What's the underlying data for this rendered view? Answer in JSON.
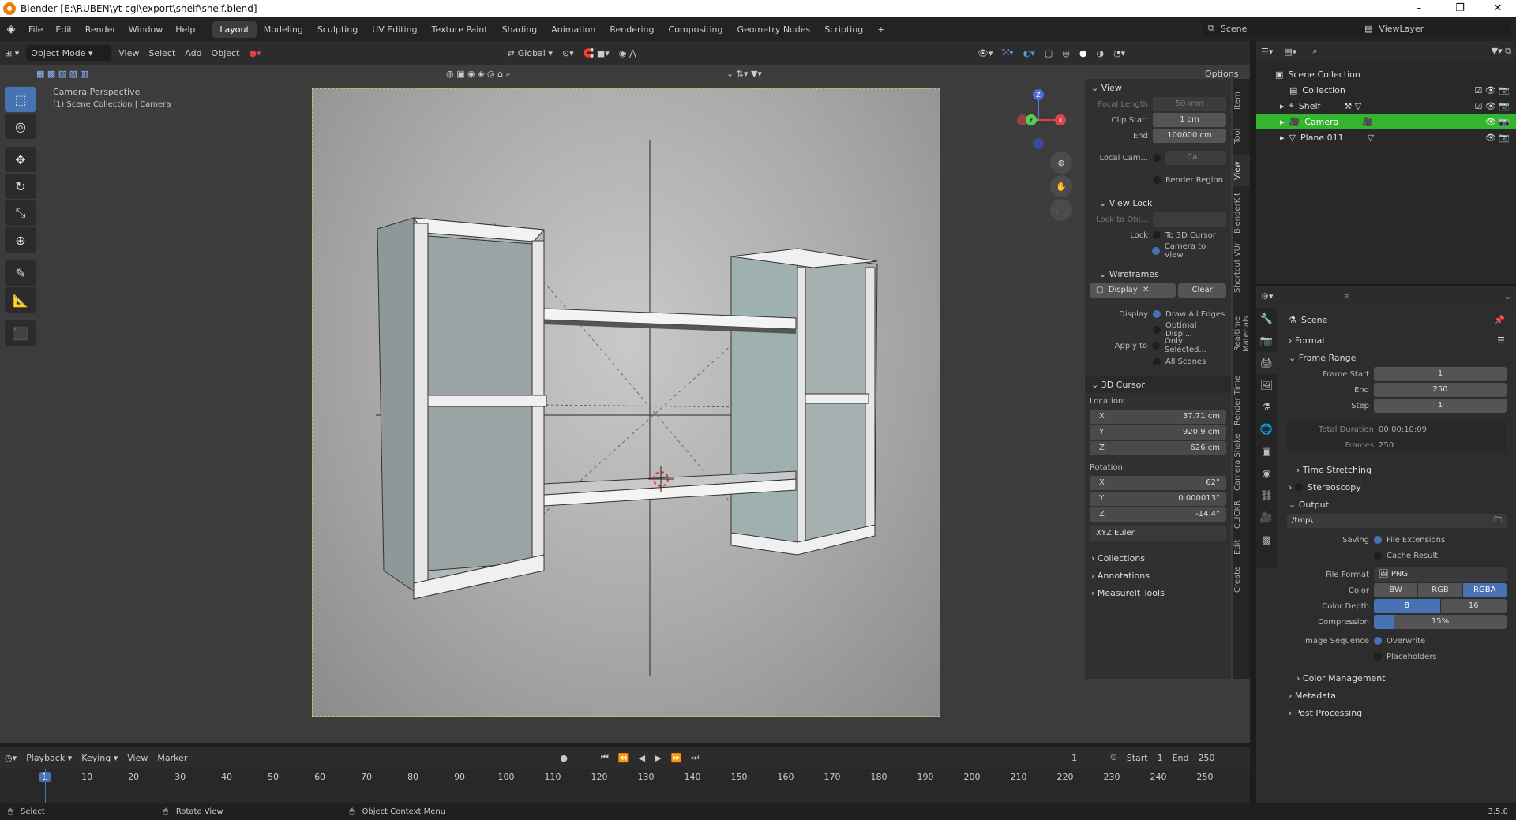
{
  "window": {
    "title": "Blender [E:\\RUBEN\\yt cgi\\export\\shelf\\shelf.blend]",
    "min": "–",
    "max": "❐",
    "close": "✕"
  },
  "menus": [
    "File",
    "Edit",
    "Render",
    "Window",
    "Help"
  ],
  "workspaces": [
    "Layout",
    "Modeling",
    "Sculpting",
    "UV Editing",
    "Texture Paint",
    "Shading",
    "Animation",
    "Rendering",
    "Compositing",
    "Geometry Nodes",
    "Scripting",
    "+"
  ],
  "scene": "Scene",
  "view_layer": "ViewLayer",
  "vp_header": {
    "mode": "Object Mode",
    "view": "View",
    "select": "Select",
    "add": "Add",
    "object": "Object",
    "orientation": "Global",
    "options": "Options"
  },
  "viewport": {
    "persp_label": "Camera Perspective",
    "context_label": "(1) Scene Collection | Camera"
  },
  "gizmo": {
    "x": "X",
    "y": "Y",
    "z": "Z"
  },
  "npanel": {
    "view_title": "View",
    "focal_length_label": "Focal Length",
    "focal_length": "50 mm",
    "clip_start_label": "Clip Start",
    "clip_start": "1 cm",
    "end_label": "End",
    "clip_end": "100000 cm",
    "local_cam_label": "Local Cam...",
    "local_cam": "Ca...",
    "render_region": "Render Region",
    "view_lock": "View Lock",
    "lock_to_obj": "Lock to Obj...",
    "lock_label": "Lock",
    "to_3d_cursor": "To 3D Cursor",
    "camera_to_view": "Camera to View",
    "wireframes": "Wireframes",
    "display_btn": "Display",
    "clear_btn": "Clear",
    "display_label": "Display",
    "draw_all_edges": "Draw All Edges",
    "optimal_display": "Optimal Displ...",
    "apply_to_label": "Apply to",
    "only_selected": "Only Selected...",
    "all_scenes": "All Scenes",
    "cursor_title": "3D Cursor",
    "location_label": "Location:",
    "loc_x": "37.71 cm",
    "loc_y": "920.9 cm",
    "loc_z": "626 cm",
    "rotation_label": "Rotation:",
    "rot_x": "62°",
    "rot_y": "0.000013°",
    "rot_z": "-14.4°",
    "rot_mode": "XYZ Euler",
    "collections": "Collections",
    "annotations": "Annotations",
    "measureit": "MeasureIt Tools",
    "axis_x": "X",
    "axis_y": "Y",
    "axis_z": "Z"
  },
  "ntabs": [
    "Item",
    "Tool",
    "View",
    "BlenderKit",
    "Shortcut VUr",
    "Realtime Materials",
    "Render Time",
    "Camera Shake",
    "CLICKR",
    "Edit",
    "Create"
  ],
  "outliner": {
    "root": "Scene Collection",
    "items": [
      "Collection",
      "Shelf",
      "Camera",
      "Plane.011"
    ]
  },
  "properties": {
    "scene": "Scene",
    "format": "Format",
    "frame_range": "Frame Range",
    "frame_start_label": "Frame Start",
    "frame_start": "1",
    "end_label": "End",
    "frame_end": "250",
    "step_label": "Step",
    "step": "1",
    "total_duration_label": "Total Duration",
    "total_duration": "00:00:10:09",
    "frames_label": "Frames",
    "frames": "250",
    "time_stretching": "Time Stretching",
    "stereoscopy": "Stereoscopy",
    "output": "Output",
    "output_path": "/tmp\\",
    "saving_label": "Saving",
    "file_extensions": "File Extensions",
    "cache_result": "Cache Result",
    "file_format_label": "File Format",
    "file_format": "PNG",
    "color_label": "Color",
    "bw": "BW",
    "rgb": "RGB",
    "rgba": "RGBA",
    "color_depth_label": "Color Depth",
    "depth_8": "8",
    "depth_16": "16",
    "compression_label": "Compression",
    "compression": "15%",
    "image_sequence_label": "Image Sequence",
    "overwrite": "Overwrite",
    "placeholders": "Placeholders",
    "color_management": "Color Management",
    "metadata": "Metadata",
    "post_processing": "Post Processing"
  },
  "timeline": {
    "playback": "Playback",
    "keying": "Keying",
    "view": "View",
    "marker": "Marker",
    "current_frame": "1",
    "start_label": "Start",
    "start": "1",
    "end_label": "End",
    "end": "250",
    "ticks": [
      "1",
      "10",
      "20",
      "30",
      "40",
      "50",
      "60",
      "70",
      "80",
      "90",
      "100",
      "110",
      "120",
      "130",
      "140",
      "150",
      "160",
      "170",
      "180",
      "190",
      "200",
      "210",
      "220",
      "230",
      "240",
      "250"
    ]
  },
  "status": {
    "select": "Select",
    "rotate": "Rotate View",
    "context": "Object Context Menu",
    "version": "3.5.0"
  }
}
